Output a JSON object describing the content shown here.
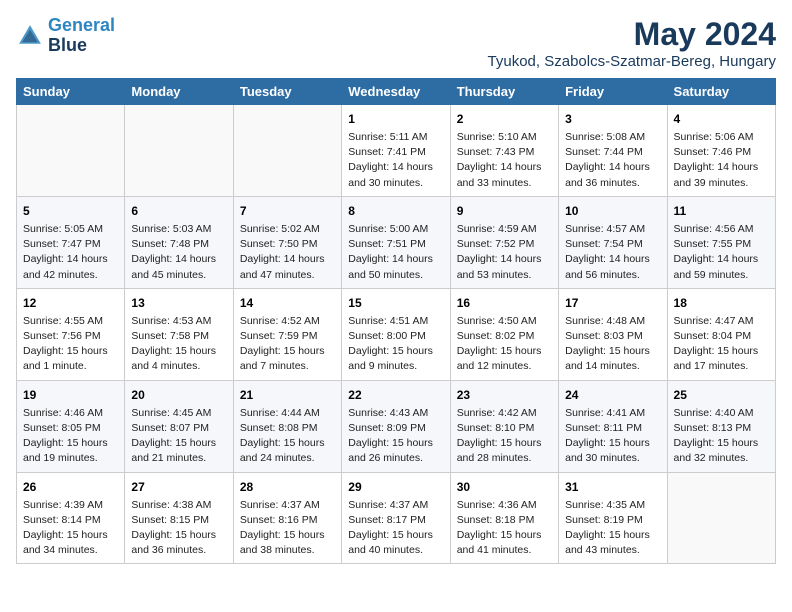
{
  "header": {
    "logo_line1": "General",
    "logo_line2": "Blue",
    "month": "May 2024",
    "location": "Tyukod, Szabolcs-Szatmar-Bereg, Hungary"
  },
  "weekdays": [
    "Sunday",
    "Monday",
    "Tuesday",
    "Wednesday",
    "Thursday",
    "Friday",
    "Saturday"
  ],
  "weeks": [
    [
      {
        "day": "",
        "info": ""
      },
      {
        "day": "",
        "info": ""
      },
      {
        "day": "",
        "info": ""
      },
      {
        "day": "1",
        "info": "Sunrise: 5:11 AM\nSunset: 7:41 PM\nDaylight: 14 hours\nand 30 minutes."
      },
      {
        "day": "2",
        "info": "Sunrise: 5:10 AM\nSunset: 7:43 PM\nDaylight: 14 hours\nand 33 minutes."
      },
      {
        "day": "3",
        "info": "Sunrise: 5:08 AM\nSunset: 7:44 PM\nDaylight: 14 hours\nand 36 minutes."
      },
      {
        "day": "4",
        "info": "Sunrise: 5:06 AM\nSunset: 7:46 PM\nDaylight: 14 hours\nand 39 minutes."
      }
    ],
    [
      {
        "day": "5",
        "info": "Sunrise: 5:05 AM\nSunset: 7:47 PM\nDaylight: 14 hours\nand 42 minutes."
      },
      {
        "day": "6",
        "info": "Sunrise: 5:03 AM\nSunset: 7:48 PM\nDaylight: 14 hours\nand 45 minutes."
      },
      {
        "day": "7",
        "info": "Sunrise: 5:02 AM\nSunset: 7:50 PM\nDaylight: 14 hours\nand 47 minutes."
      },
      {
        "day": "8",
        "info": "Sunrise: 5:00 AM\nSunset: 7:51 PM\nDaylight: 14 hours\nand 50 minutes."
      },
      {
        "day": "9",
        "info": "Sunrise: 4:59 AM\nSunset: 7:52 PM\nDaylight: 14 hours\nand 53 minutes."
      },
      {
        "day": "10",
        "info": "Sunrise: 4:57 AM\nSunset: 7:54 PM\nDaylight: 14 hours\nand 56 minutes."
      },
      {
        "day": "11",
        "info": "Sunrise: 4:56 AM\nSunset: 7:55 PM\nDaylight: 14 hours\nand 59 minutes."
      }
    ],
    [
      {
        "day": "12",
        "info": "Sunrise: 4:55 AM\nSunset: 7:56 PM\nDaylight: 15 hours\nand 1 minute."
      },
      {
        "day": "13",
        "info": "Sunrise: 4:53 AM\nSunset: 7:58 PM\nDaylight: 15 hours\nand 4 minutes."
      },
      {
        "day": "14",
        "info": "Sunrise: 4:52 AM\nSunset: 7:59 PM\nDaylight: 15 hours\nand 7 minutes."
      },
      {
        "day": "15",
        "info": "Sunrise: 4:51 AM\nSunset: 8:00 PM\nDaylight: 15 hours\nand 9 minutes."
      },
      {
        "day": "16",
        "info": "Sunrise: 4:50 AM\nSunset: 8:02 PM\nDaylight: 15 hours\nand 12 minutes."
      },
      {
        "day": "17",
        "info": "Sunrise: 4:48 AM\nSunset: 8:03 PM\nDaylight: 15 hours\nand 14 minutes."
      },
      {
        "day": "18",
        "info": "Sunrise: 4:47 AM\nSunset: 8:04 PM\nDaylight: 15 hours\nand 17 minutes."
      }
    ],
    [
      {
        "day": "19",
        "info": "Sunrise: 4:46 AM\nSunset: 8:05 PM\nDaylight: 15 hours\nand 19 minutes."
      },
      {
        "day": "20",
        "info": "Sunrise: 4:45 AM\nSunset: 8:07 PM\nDaylight: 15 hours\nand 21 minutes."
      },
      {
        "day": "21",
        "info": "Sunrise: 4:44 AM\nSunset: 8:08 PM\nDaylight: 15 hours\nand 24 minutes."
      },
      {
        "day": "22",
        "info": "Sunrise: 4:43 AM\nSunset: 8:09 PM\nDaylight: 15 hours\nand 26 minutes."
      },
      {
        "day": "23",
        "info": "Sunrise: 4:42 AM\nSunset: 8:10 PM\nDaylight: 15 hours\nand 28 minutes."
      },
      {
        "day": "24",
        "info": "Sunrise: 4:41 AM\nSunset: 8:11 PM\nDaylight: 15 hours\nand 30 minutes."
      },
      {
        "day": "25",
        "info": "Sunrise: 4:40 AM\nSunset: 8:13 PM\nDaylight: 15 hours\nand 32 minutes."
      }
    ],
    [
      {
        "day": "26",
        "info": "Sunrise: 4:39 AM\nSunset: 8:14 PM\nDaylight: 15 hours\nand 34 minutes."
      },
      {
        "day": "27",
        "info": "Sunrise: 4:38 AM\nSunset: 8:15 PM\nDaylight: 15 hours\nand 36 minutes."
      },
      {
        "day": "28",
        "info": "Sunrise: 4:37 AM\nSunset: 8:16 PM\nDaylight: 15 hours\nand 38 minutes."
      },
      {
        "day": "29",
        "info": "Sunrise: 4:37 AM\nSunset: 8:17 PM\nDaylight: 15 hours\nand 40 minutes."
      },
      {
        "day": "30",
        "info": "Sunrise: 4:36 AM\nSunset: 8:18 PM\nDaylight: 15 hours\nand 41 minutes."
      },
      {
        "day": "31",
        "info": "Sunrise: 4:35 AM\nSunset: 8:19 PM\nDaylight: 15 hours\nand 43 minutes."
      },
      {
        "day": "",
        "info": ""
      }
    ]
  ]
}
